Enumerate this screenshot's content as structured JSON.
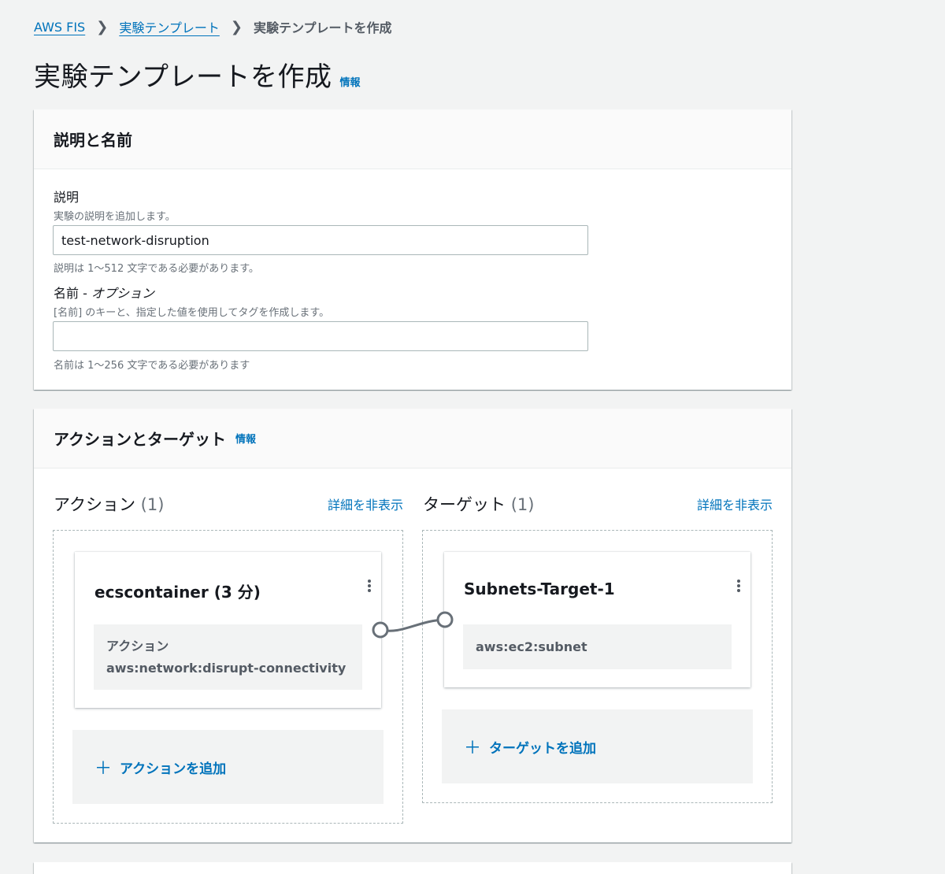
{
  "breadcrumb": {
    "items": [
      {
        "label": "AWS FIS",
        "link": true
      },
      {
        "label": "実験テンプレート",
        "link": true
      },
      {
        "label": "実験テンプレートを作成",
        "link": false
      }
    ],
    "separator": "❯"
  },
  "page": {
    "title": "実験テンプレートを作成",
    "info_label": "情報"
  },
  "description_section": {
    "header": "説明と名前",
    "description": {
      "label": "説明",
      "help": "実験の説明を追加します。",
      "value": "test-network-disruption",
      "constraint": "説明は 1〜512 文字である必要があります。"
    },
    "name": {
      "label": "名前 - ",
      "optional": "オプション",
      "help": "[名前] のキーと、指定した値を使用してタグを作成します。",
      "value": "",
      "constraint": "名前は 1〜256 文字である必要があります"
    }
  },
  "actions_targets_section": {
    "header": "アクションとターゲット",
    "info_label": "情報",
    "actions": {
      "title": "アクション",
      "count": "(1)",
      "toggle_label": "詳細を非表示",
      "card": {
        "title": "ecscontainer (3 分)",
        "body_label": "アクション",
        "body_value": "aws:network:disrupt-connectivity"
      },
      "add_label": "アクションを追加"
    },
    "targets": {
      "title": "ターゲット",
      "count": "(1)",
      "toggle_label": "詳細を非表示",
      "card": {
        "title": "Subnets-Target-1",
        "body_value": "aws:ec2:subnet"
      },
      "add_label": "ターゲットを追加"
    }
  },
  "colors": {
    "link": "#0073bb",
    "background": "#f2f3f3",
    "text": "#16191f",
    "muted": "#687078"
  }
}
